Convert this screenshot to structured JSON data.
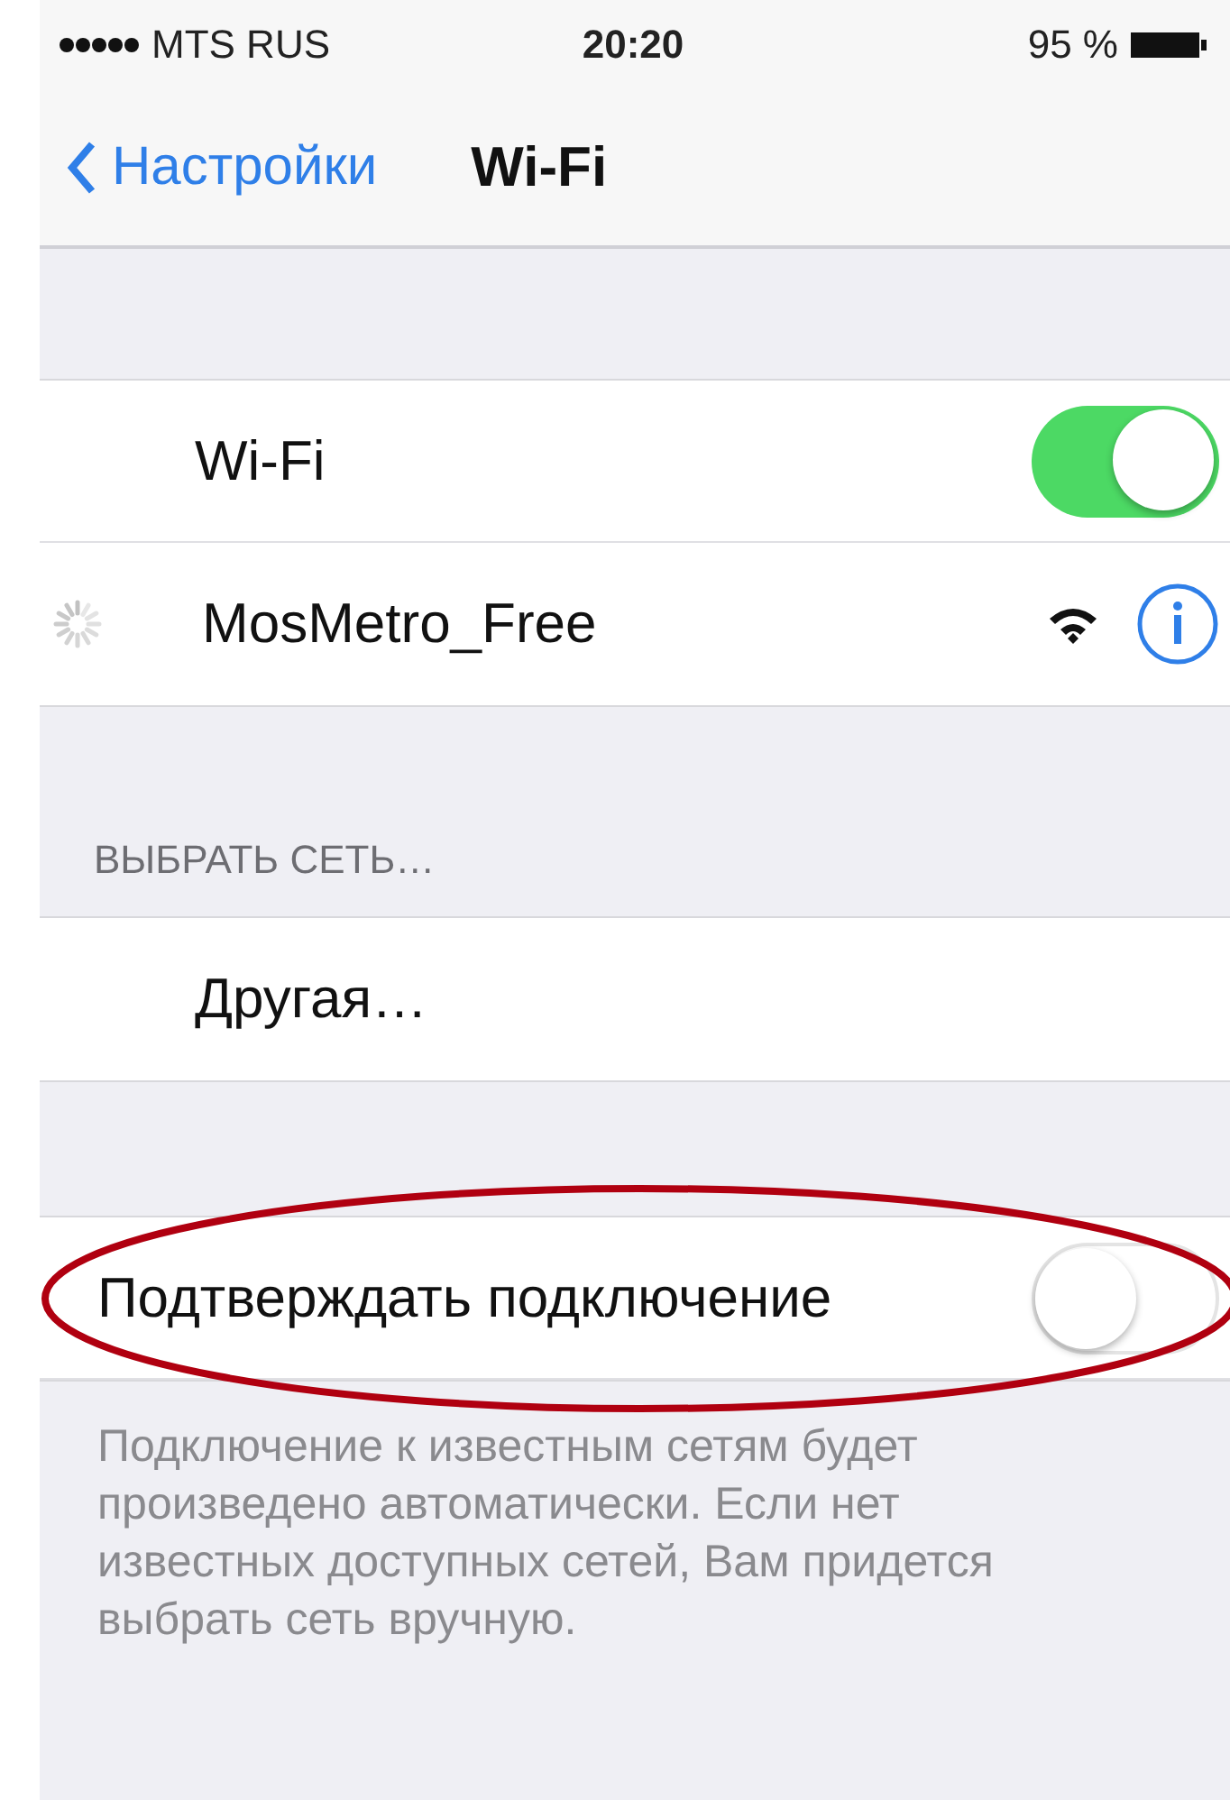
{
  "status_bar": {
    "carrier": "MTS RUS",
    "time": "20:20",
    "battery": "95 %"
  },
  "nav": {
    "back": "Настройки",
    "title": "Wi-Fi"
  },
  "wifi": {
    "label": "Wi-Fi",
    "on": true
  },
  "current_network": {
    "name": "MosMetro_Free"
  },
  "section_header": "ВЫБРАТЬ СЕТЬ…",
  "other_network": "Другая…",
  "ask_to_join": {
    "label": "Подтверждать подключение",
    "on": false
  },
  "footer": "Подключение к известным сетям будет произведено автоматически. Если нет известных доступных сетей, Вам придется выбрать сеть вручную."
}
